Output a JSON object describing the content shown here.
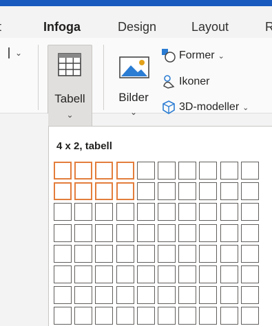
{
  "tabs": [
    {
      "label": "t",
      "active": false
    },
    {
      "label": "Infoga",
      "active": true
    },
    {
      "label": "Design",
      "active": false
    },
    {
      "label": "Layout",
      "active": false
    },
    {
      "label": "R",
      "active": false
    }
  ],
  "ribbon": {
    "tabell": {
      "label": "Tabell"
    },
    "bilder": {
      "label": "Bilder"
    },
    "former": {
      "label": "Former"
    },
    "ikoner": {
      "label": "Ikoner"
    },
    "modeller": {
      "label": "3D-modeller"
    }
  },
  "table_picker": {
    "header": "4 x 2, tabell",
    "columns": 10,
    "rows": 8,
    "selected_columns": 4,
    "selected_rows": 2
  },
  "colors": {
    "accent": "#185abd",
    "selection": "#e37d3b",
    "icon_blue": "#2b7cd3"
  }
}
